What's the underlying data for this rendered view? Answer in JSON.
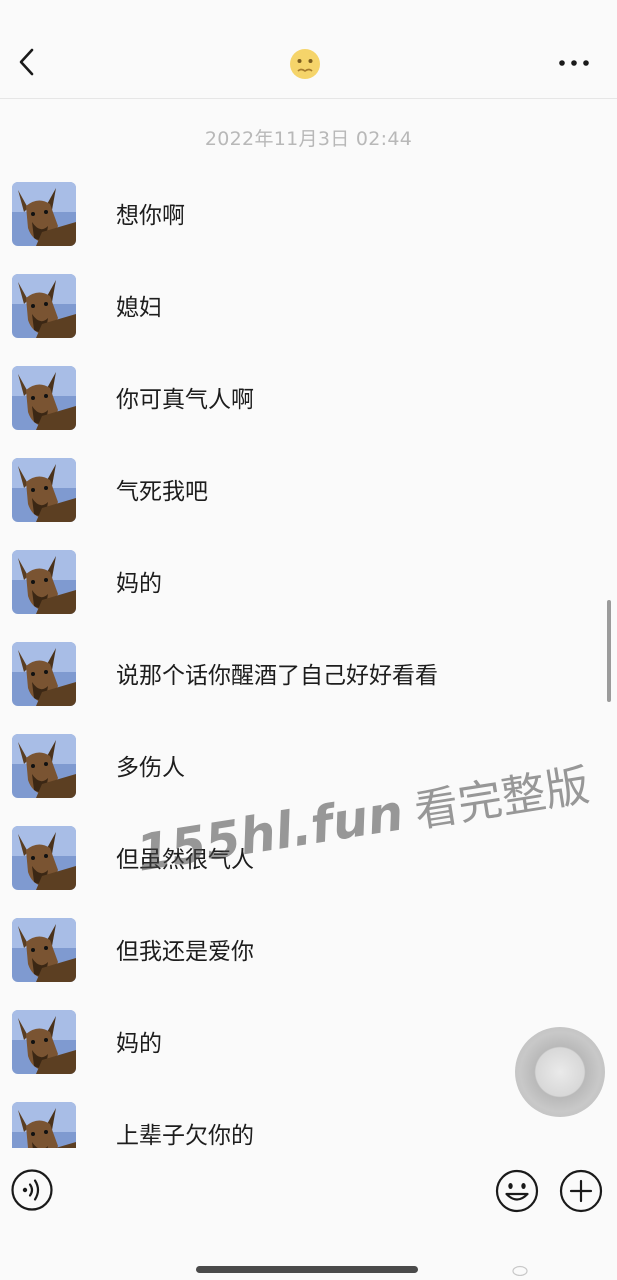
{
  "header": {
    "back_icon": "chevron-left-icon",
    "contact_avatar_icon": "pleading-face-emoji-icon",
    "more_icon": "ellipsis-icon"
  },
  "timestamp": "2022年11月3日 02:44",
  "messages": [
    {
      "text": "想你啊"
    },
    {
      "text": "媳妇"
    },
    {
      "text": "你可真气人啊"
    },
    {
      "text": "气死我吧"
    },
    {
      "text": "妈的"
    },
    {
      "text": "说那个话你醒酒了自己好好看看"
    },
    {
      "text": "多伤人"
    },
    {
      "text": "但虽然很气人"
    },
    {
      "text": "但我还是爱你"
    },
    {
      "text": "妈的"
    },
    {
      "text": "上辈子欠你的"
    }
  ],
  "watermark": {
    "site": "155hl.fun",
    "text": "看完整版"
  },
  "input_bar": {
    "voice_icon": "voice-icon",
    "emoji_icon": "smiley-icon",
    "plus_icon": "plus-circle-icon"
  },
  "colors": {
    "background": "#fafafa",
    "timestamp": "#b8b8b8",
    "avatar_bg": "#7f9ad0"
  }
}
